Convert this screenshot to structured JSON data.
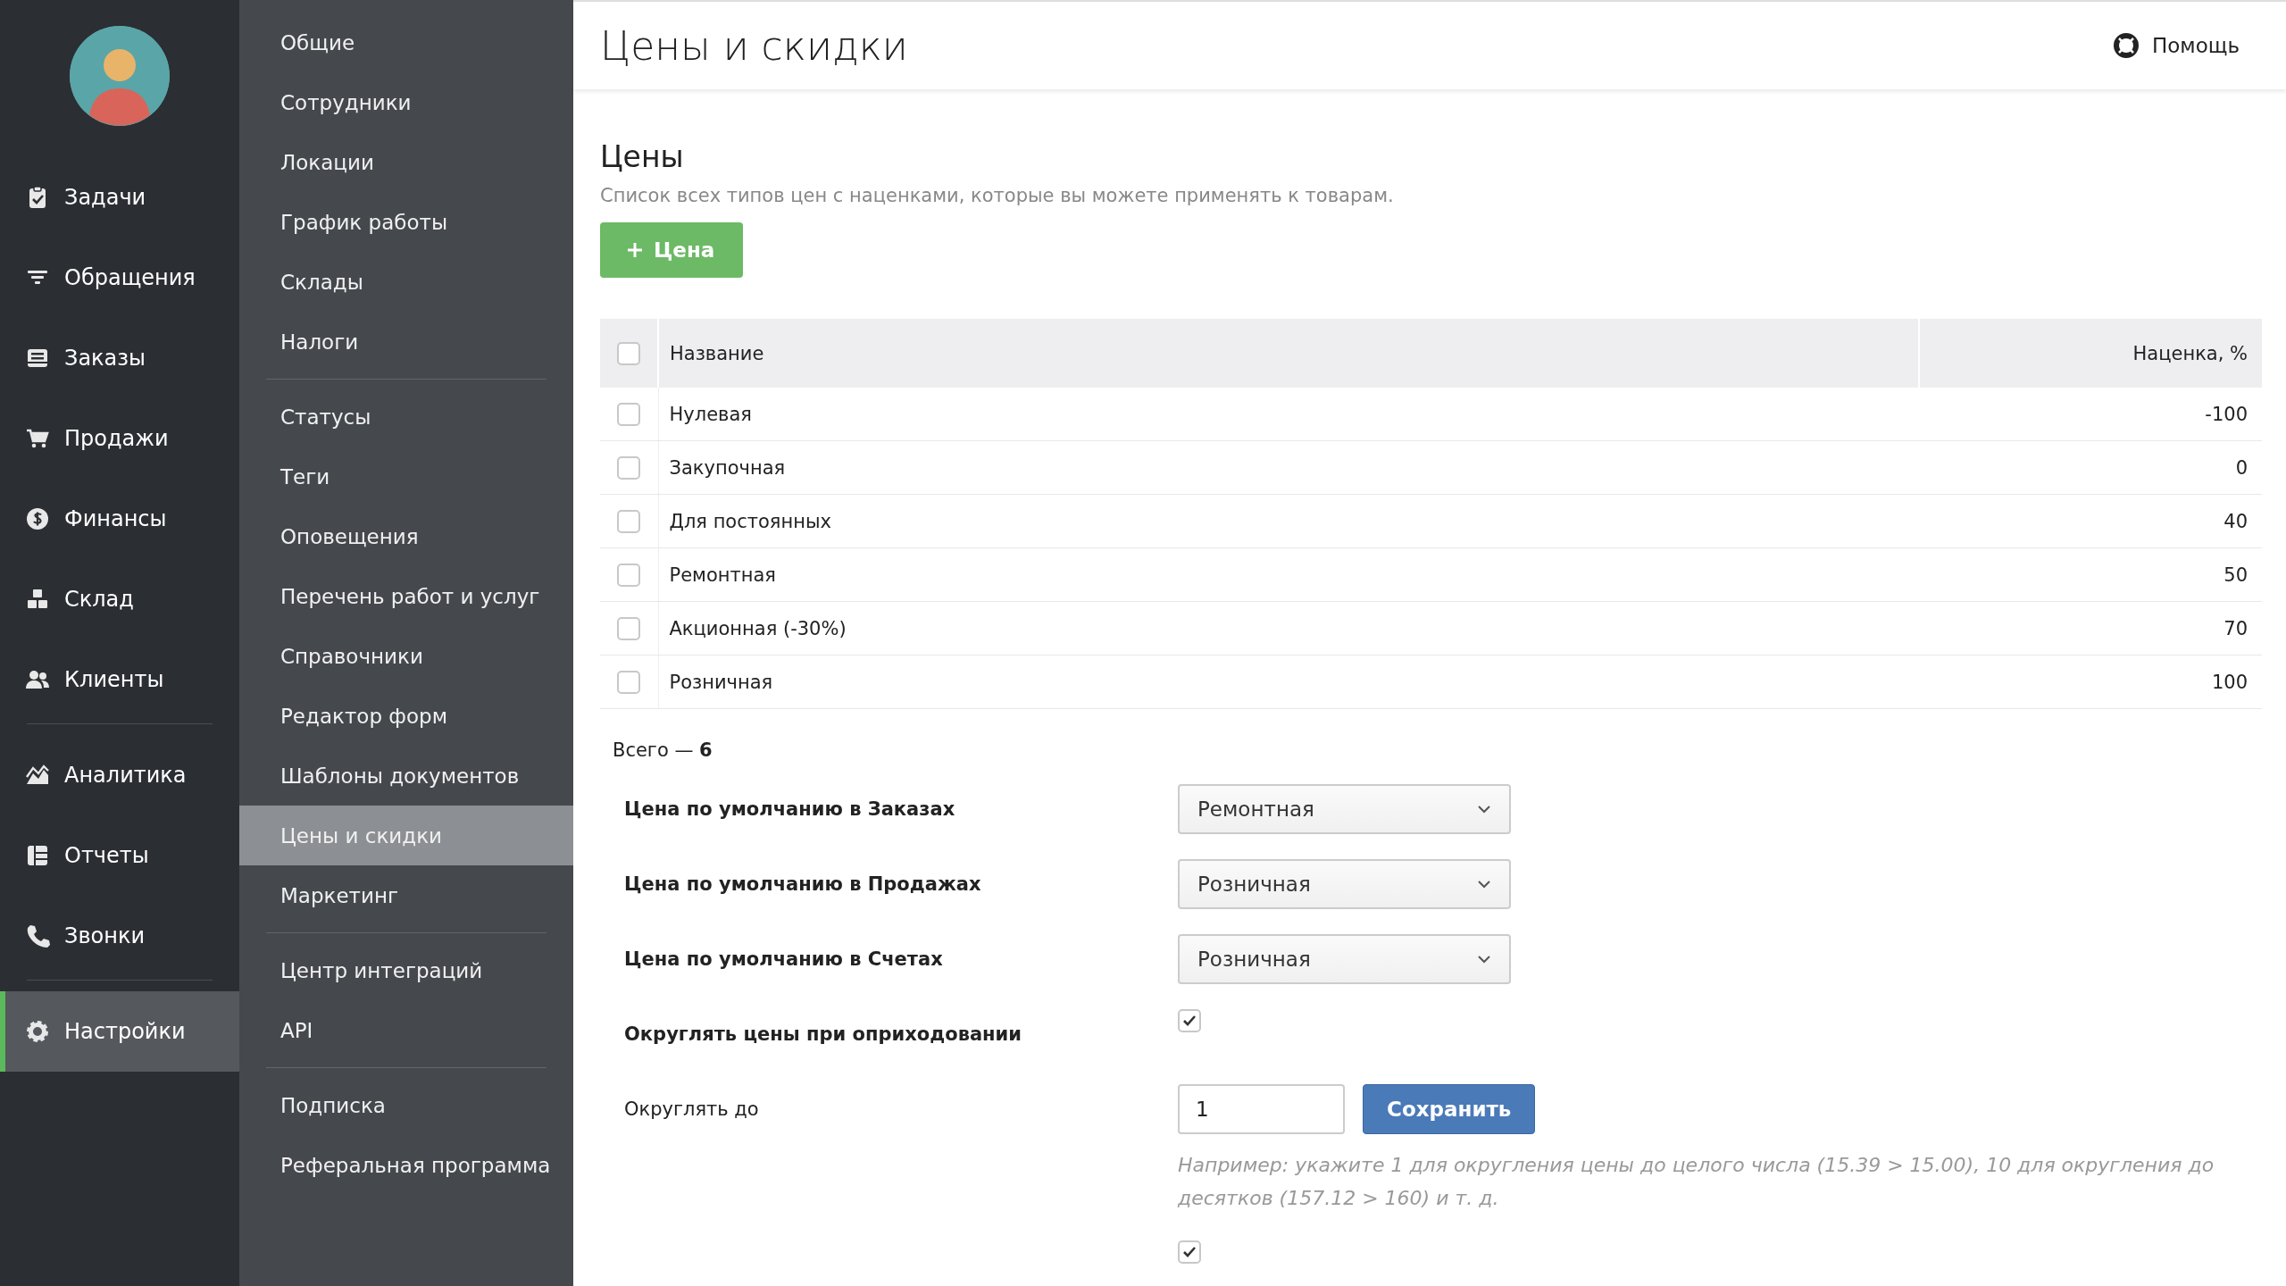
{
  "main_menu": {
    "groups": [
      {
        "items": [
          {
            "label": "Задачи",
            "selected": false
          },
          {
            "label": "Обращения",
            "selected": false
          },
          {
            "label": "Заказы",
            "selected": false
          },
          {
            "label": "Продажи",
            "selected": false
          },
          {
            "label": "Финансы",
            "selected": false
          },
          {
            "label": "Склад",
            "selected": false
          },
          {
            "label": "Клиенты",
            "selected": false
          }
        ]
      },
      {
        "items": [
          {
            "label": "Аналитика",
            "selected": false
          },
          {
            "label": "Отчеты",
            "selected": false
          },
          {
            "label": "Звонки",
            "selected": false
          }
        ]
      },
      {
        "items": [
          {
            "label": "Настройки",
            "selected": true
          }
        ]
      }
    ]
  },
  "settings_menu": {
    "groups": [
      {
        "items": [
          {
            "label": "Общие",
            "selected": false
          },
          {
            "label": "Сотрудники",
            "selected": false
          },
          {
            "label": "Локации",
            "selected": false
          },
          {
            "label": "График работы",
            "selected": false
          },
          {
            "label": "Склады",
            "selected": false
          },
          {
            "label": "Налоги",
            "selected": false
          }
        ]
      },
      {
        "items": [
          {
            "label": "Статусы",
            "selected": false
          },
          {
            "label": "Теги",
            "selected": false
          },
          {
            "label": "Оповещения",
            "selected": false
          },
          {
            "label": "Перечень работ и услуг",
            "selected": false
          },
          {
            "label": "Справочники",
            "selected": false
          },
          {
            "label": "Редактор форм",
            "selected": false
          },
          {
            "label": "Шаблоны документов",
            "selected": false
          },
          {
            "label": "Цены и скидки",
            "selected": true
          },
          {
            "label": "Маркетинг",
            "selected": false
          }
        ]
      },
      {
        "items": [
          {
            "label": "Центр интеграций",
            "selected": false
          },
          {
            "label": "API",
            "selected": false
          }
        ]
      },
      {
        "items": [
          {
            "label": "Подписка",
            "selected": false
          },
          {
            "label": "Реферальная программа",
            "selected": false
          }
        ]
      }
    ]
  },
  "header": {
    "title": "Цены и скидки",
    "help": "Помощь"
  },
  "prices": {
    "title": "Цены",
    "description": "Список всех типов цен с наценками, которые вы можете применять к товарам.",
    "add_button": "Цена",
    "table": {
      "columns": [
        "Название",
        "Наценка, %"
      ],
      "header_checked": false,
      "rows": [
        {
          "name": "Нулевая",
          "markup": "-100",
          "checked": false
        },
        {
          "name": "Закупочная",
          "markup": "0",
          "checked": false
        },
        {
          "name": "Для постоянных",
          "markup": "40",
          "checked": false
        },
        {
          "name": "Ремонтная",
          "markup": "50",
          "checked": false
        },
        {
          "name": "Акционная (-30%)",
          "markup": "70",
          "checked": false
        },
        {
          "name": "Розничная",
          "markup": "100",
          "checked": false
        }
      ]
    },
    "total": "Всего — **6**"
  },
  "settings": [
    {
      "kind": "select",
      "label": "Цена по умолчанию в Заказах",
      "value": "Ремонтная"
    },
    {
      "kind": "select",
      "label": "Цена по умолчанию в Продажах",
      "value": "Розничная"
    },
    {
      "kind": "select",
      "label": "Цена по умолчанию в Счетах",
      "value": "Розничная"
    },
    {
      "kind": "checkbox",
      "label": "Округлять цены при оприходовании",
      "checked": true
    },
    {
      "kind": "number",
      "label": "Округлять до",
      "value": "1",
      "button": "Сохранить",
      "hint": "Например: укажите 1 для округления цены до целого числа (15.39 > 15.00), 10 для округления до десятков (157.12 > 160) и т. д."
    },
    {
      "kind": "checkbox",
      "checked": true
    }
  ]
}
